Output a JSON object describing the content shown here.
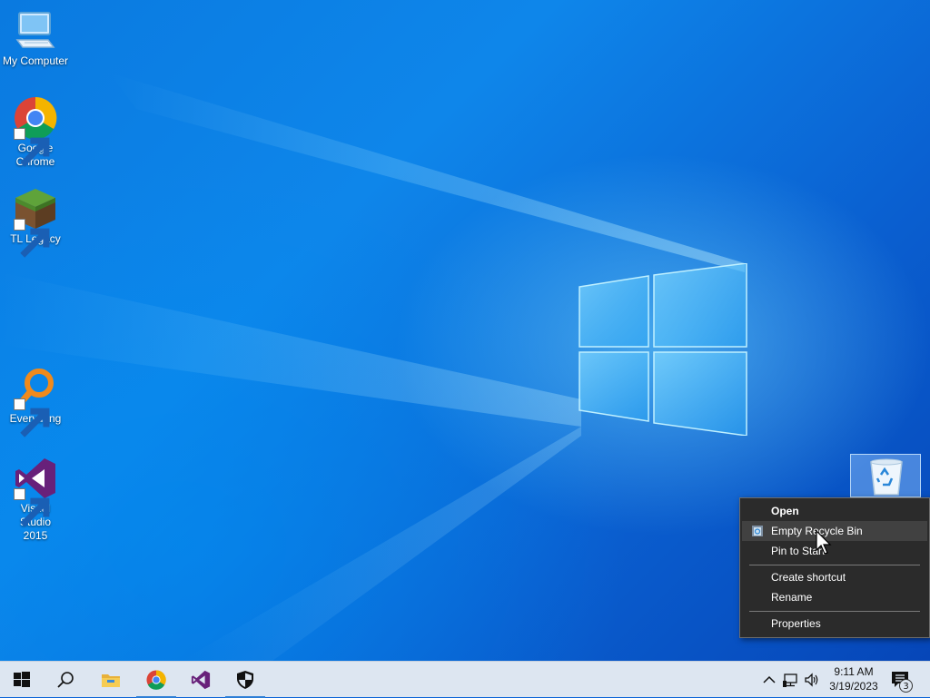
{
  "desktop_icons": [
    {
      "label": "My Computer",
      "icon": "computer-icon"
    },
    {
      "label": "Google Chrome",
      "icon": "chrome-icon"
    },
    {
      "label": "TL Legacy",
      "icon": "minecraft-grass-block-icon"
    },
    {
      "label": "Everything",
      "icon": "magnifier-icon"
    },
    {
      "label": "Visual Studio 2015",
      "icon": "visual-studio-icon"
    }
  ],
  "recycle_bin": {
    "icon": "recycle-bin-icon"
  },
  "context_menu": {
    "items": [
      "Open",
      "Empty Recycle Bin",
      "Pin to Start",
      "Create shortcut",
      "Rename",
      "Properties"
    ]
  },
  "taskbar": {
    "pinned": [
      "start-icon",
      "search-icon",
      "file-explorer-icon",
      "chrome-icon",
      "visual-studio-icon",
      "shield-icon"
    ],
    "tray": [
      "chevron-up-icon",
      "network-icon",
      "volume-icon"
    ],
    "clock": {
      "time": "9:11 AM",
      "date": "3/19/2023"
    },
    "notification_count": "3"
  },
  "colors": {
    "accent": "#0a63d8",
    "menu_bg": "#2b2b2b",
    "taskbar_bg": "#dde6f1"
  }
}
